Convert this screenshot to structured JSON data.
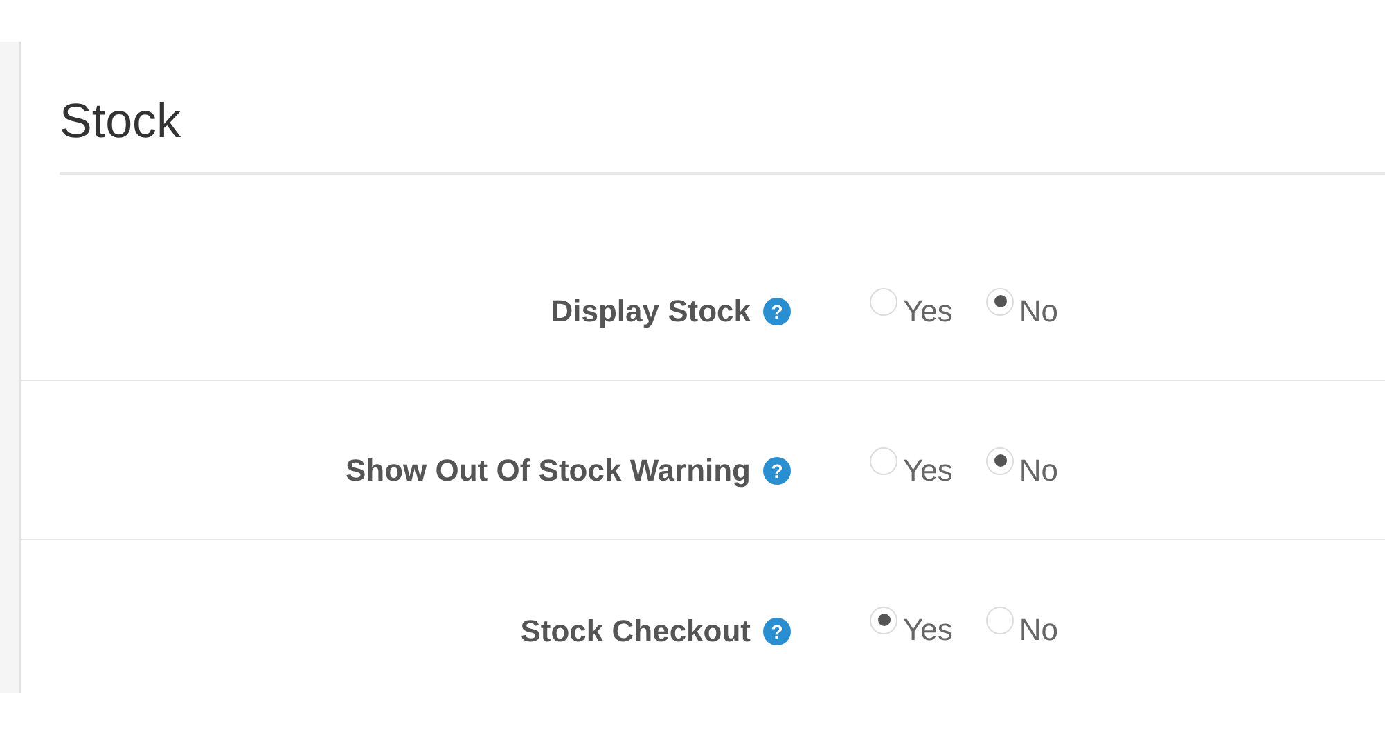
{
  "section": {
    "title": "Stock"
  },
  "settings": [
    {
      "label": "Display Stock",
      "help": "?",
      "options": [
        {
          "label": "Yes",
          "selected": false
        },
        {
          "label": "No",
          "selected": true
        }
      ]
    },
    {
      "label": "Show Out Of Stock Warning",
      "help": "?",
      "options": [
        {
          "label": "Yes",
          "selected": false
        },
        {
          "label": "No",
          "selected": true
        }
      ]
    },
    {
      "label": "Stock Checkout",
      "help": "?",
      "options": [
        {
          "label": "Yes",
          "selected": true
        },
        {
          "label": "No",
          "selected": false
        }
      ]
    }
  ]
}
